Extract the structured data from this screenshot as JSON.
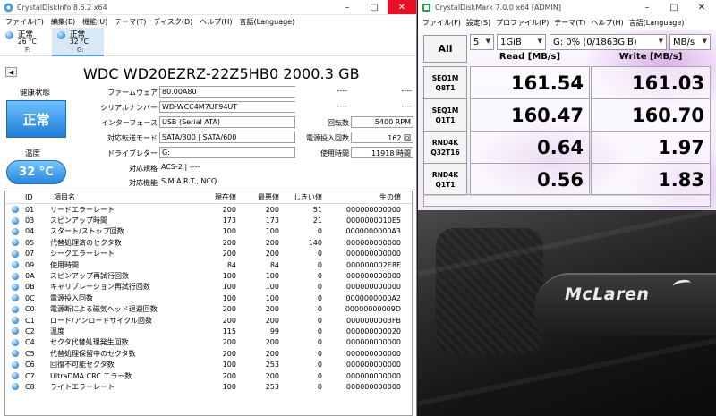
{
  "cdi": {
    "title": "CrystalDiskInfo 8.6.2 x64",
    "menu": [
      "ファイル(F)",
      "編集(E)",
      "機能(U)",
      "テーマ(T)",
      "ディスク(D)",
      "ヘルプ(H)",
      "言語(Language)"
    ],
    "disks": [
      {
        "status": "正常",
        "temp": "26 °C",
        "drive": "F:"
      },
      {
        "status": "正常",
        "temp": "32 °C",
        "drive": "G:"
      }
    ],
    "model": "WDC WD20EZRZ-22Z5HB0 2000.3 GB",
    "health_label": "健康状態",
    "health_value": "正常",
    "temp_label": "温度",
    "temp_value": "32 °C",
    "info": {
      "firmware_label": "ファームウェア",
      "firmware": "80.00A80",
      "serial_label": "シリアルナンバー",
      "serial": "WD-WCC4M7UF94UT",
      "interface_label": "インターフェース",
      "interface": "USB (Serial ATA)",
      "transfer_label": "対応転送モード",
      "transfer": "SATA/300 | SATA/600",
      "letter_label": "ドライブレター",
      "letter": "G:",
      "standard_label": "対応規格",
      "standard": "ACS-2 | ----",
      "features_label": "対応機能",
      "features": "S.M.A.R.T., NCQ",
      "right1_a": "----",
      "right1_b": "----",
      "right2_a": "----",
      "right2_b": "----",
      "rotation_label": "回転数",
      "rotation": "5400 RPM",
      "poweron_count_label": "電源投入回数",
      "poweron_count": "162 回",
      "poweron_hours_label": "使用時間",
      "poweron_hours": "11918 時間"
    },
    "smart_headers": {
      "id": "ID",
      "name": "項目名",
      "current": "現在値",
      "worst": "最悪値",
      "threshold": "しきい値",
      "raw": "生の値"
    },
    "smart": [
      {
        "id": "01",
        "name": "リードエラーレート",
        "current": "200",
        "worst": "200",
        "threshold": "51",
        "raw": "000000000000"
      },
      {
        "id": "03",
        "name": "スピンアップ時間",
        "current": "173",
        "worst": "173",
        "threshold": "21",
        "raw": "0000000010E5"
      },
      {
        "id": "04",
        "name": "スタート/ストップ回数",
        "current": "100",
        "worst": "100",
        "threshold": "0",
        "raw": "0000000000A3"
      },
      {
        "id": "05",
        "name": "代替処理済のセクタ数",
        "current": "200",
        "worst": "200",
        "threshold": "140",
        "raw": "000000000000"
      },
      {
        "id": "07",
        "name": "シークエラーレート",
        "current": "200",
        "worst": "200",
        "threshold": "0",
        "raw": "000000000000"
      },
      {
        "id": "09",
        "name": "使用時間",
        "current": "84",
        "worst": "84",
        "threshold": "0",
        "raw": "000000002E8E"
      },
      {
        "id": "0A",
        "name": "スピンアップ再試行回数",
        "current": "100",
        "worst": "100",
        "threshold": "0",
        "raw": "000000000000"
      },
      {
        "id": "0B",
        "name": "キャリブレーション再試行回数",
        "current": "100",
        "worst": "100",
        "threshold": "0",
        "raw": "000000000000"
      },
      {
        "id": "0C",
        "name": "電源投入回数",
        "current": "100",
        "worst": "100",
        "threshold": "0",
        "raw": "0000000000A2"
      },
      {
        "id": "C0",
        "name": "電源断による磁気ヘッド退避回数",
        "current": "200",
        "worst": "200",
        "threshold": "0",
        "raw": "00000000009D"
      },
      {
        "id": "C1",
        "name": "ロード/アンロードサイクル回数",
        "current": "200",
        "worst": "200",
        "threshold": "0",
        "raw": "0000000003FB"
      },
      {
        "id": "C2",
        "name": "温度",
        "current": "115",
        "worst": "99",
        "threshold": "0",
        "raw": "000000000020"
      },
      {
        "id": "C4",
        "name": "セクタ代替処理発生回数",
        "current": "200",
        "worst": "200",
        "threshold": "0",
        "raw": "000000000000"
      },
      {
        "id": "C5",
        "name": "代替処理保留中のセクタ数",
        "current": "200",
        "worst": "200",
        "threshold": "0",
        "raw": "000000000000"
      },
      {
        "id": "C6",
        "name": "回復不可能セクタ数",
        "current": "100",
        "worst": "253",
        "threshold": "0",
        "raw": "000000000000"
      },
      {
        "id": "C7",
        "name": "UltraDMA CRC エラー数",
        "current": "200",
        "worst": "200",
        "threshold": "0",
        "raw": "000000000000"
      },
      {
        "id": "C8",
        "name": "ライトエラーレート",
        "current": "100",
        "worst": "253",
        "threshold": "0",
        "raw": "000000000000"
      }
    ]
  },
  "cdm": {
    "title": "CrystalDiskMark 7.0.0 x64 [ADMIN]",
    "menu": [
      "ファイル(F)",
      "設定(S)",
      "プロファイル(P)",
      "テーマ(T)",
      "ヘルプ(H)",
      "言語(Language)"
    ],
    "all_label": "All",
    "count": "5",
    "size": "1GiB",
    "drive": "G: 0% (0/1863GiB)",
    "unit": "MB/s",
    "read_header": "Read [MB/s]",
    "write_header": "Write [MB/s]",
    "tests": [
      {
        "line1": "SEQ1M",
        "line2": "Q8T1",
        "read": "161.54",
        "write": "161.03"
      },
      {
        "line1": "SEQ1M",
        "line2": "Q1T1",
        "read": "160.47",
        "write": "160.70"
      },
      {
        "line1": "RND4K",
        "line2": "Q32T16",
        "read": "0.64",
        "write": "1.97"
      },
      {
        "line1": "RND4K",
        "line2": "Q1T1",
        "read": "0.56",
        "write": "1.83"
      }
    ]
  },
  "wallpaper": {
    "logo_text": "McLaren"
  }
}
